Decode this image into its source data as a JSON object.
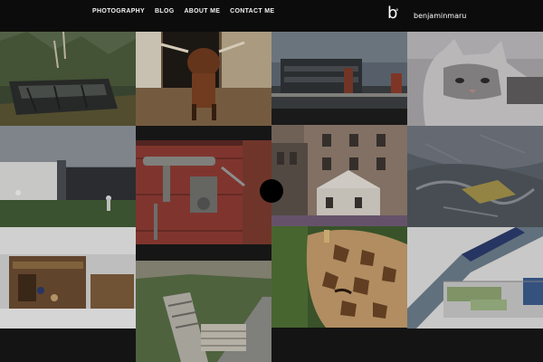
{
  "nav": {
    "items": [
      {
        "label": "PHOTOGRAPHY"
      },
      {
        "label": "BLOG"
      },
      {
        "label": "ABOUT ME"
      },
      {
        "label": "CONTACT ME"
      }
    ]
  },
  "brand": {
    "logo_letter": "b",
    "logo_mark": "°",
    "name": "benjaminmaru"
  },
  "gallery": {
    "items": [
      {
        "subject": "abandoned-boat-photo"
      },
      {
        "subject": "longhorn-cattle-photo"
      },
      {
        "subject": "modern-building-photo"
      },
      {
        "subject": "cat-photo"
      },
      {
        "subject": "architecture-render-photo"
      },
      {
        "subject": "rusty-gate-latch-photo"
      },
      {
        "subject": "old-brick-building-photo"
      },
      {
        "subject": "abstract-glass-photo"
      },
      {
        "subject": "playground-render-photo"
      },
      {
        "subject": "wooden-bench-photo"
      },
      {
        "subject": "giraffe-photo"
      },
      {
        "subject": "greenhouse-render-photo"
      }
    ]
  }
}
